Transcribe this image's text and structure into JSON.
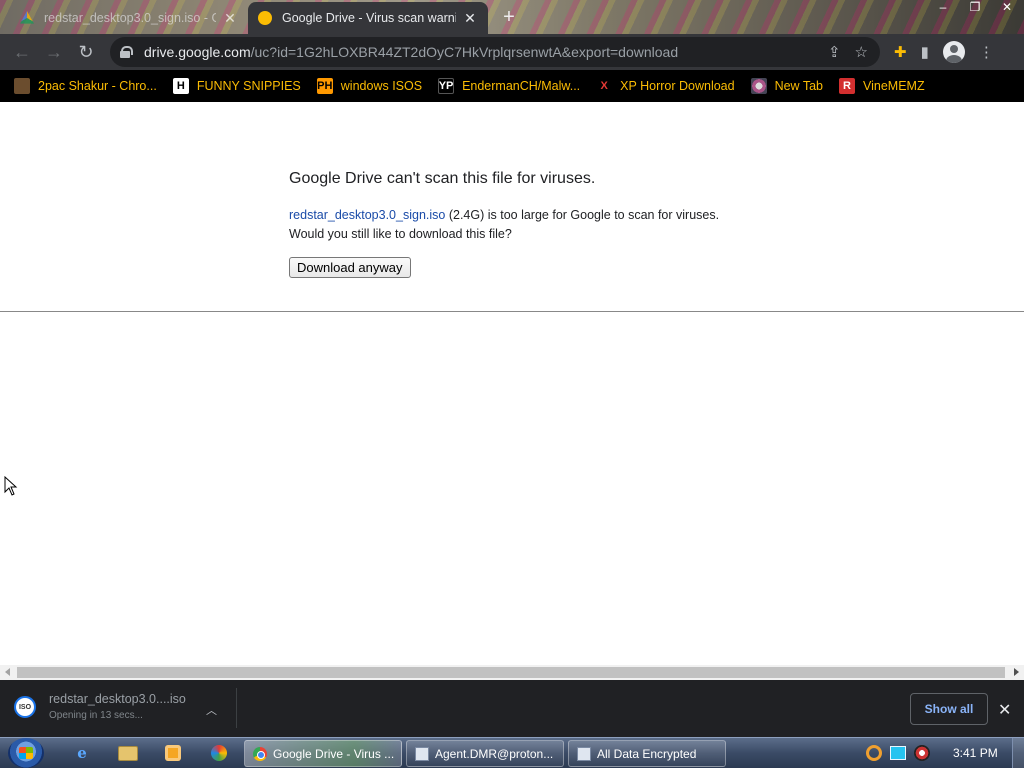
{
  "browser": {
    "tabs": [
      {
        "title": "redstar_desktop3.0_sign.iso - Go",
        "active": false
      },
      {
        "title": "Google Drive - Virus scan warnin",
        "active": true
      }
    ],
    "new_tab_label": "+",
    "url_host": "drive.google.com",
    "url_path": "/uc?id=1G2hLOXBR44ZT2dOyC7HkVrplqrsenwtA&export=download",
    "window_controls": {
      "minimize": "–",
      "restore": "❐",
      "close": "✕"
    }
  },
  "bookmarks": [
    {
      "label": "2pac Shakur - Chro...",
      "icon": "2pac-icon",
      "glyph": ""
    },
    {
      "label": "FUNNY SNIPPIES",
      "icon": "h-icon",
      "glyph": "H"
    },
    {
      "label": "windows ISOS",
      "icon": "ph-icon",
      "glyph": "PH"
    },
    {
      "label": "EndermanCH/Malw...",
      "icon": "yp-icon",
      "glyph": "YP"
    },
    {
      "label": "XP Horror Download",
      "icon": "x-icon",
      "glyph": "X"
    },
    {
      "label": "New Tab",
      "icon": "new-tab-icon",
      "glyph": ""
    },
    {
      "label": "VineMEMZ",
      "icon": "r-icon",
      "glyph": "R"
    }
  ],
  "page": {
    "title": "Google Drive can't scan this file for viruses.",
    "file_link": "redstar_desktop3.0_sign.iso",
    "line1_rest": " (2.4G) is too large for Google to scan for viruses.",
    "line2": "Would you still like to download this file?",
    "button": "Download anyway"
  },
  "download_shelf": {
    "file_name": "redstar_desktop3.0....iso",
    "status": "Opening in 13 secs...",
    "icon_text": "ISO",
    "show_all": "Show all"
  },
  "taskbar": {
    "tasks": [
      {
        "label": "Google Drive - Virus ...",
        "icon": "chrome-icon"
      },
      {
        "label": "Agent.DMR@proton...",
        "icon": "window-icon"
      },
      {
        "label": "All Data Encrypted",
        "icon": "window-icon"
      }
    ],
    "clock": "3:41 PM"
  },
  "colors": {
    "toolbar": "#35363a",
    "bookmark_text": "#fbbc04",
    "link": "#1a4ba8",
    "shelf": "#202124",
    "show_all_text": "#8ab4f8"
  }
}
